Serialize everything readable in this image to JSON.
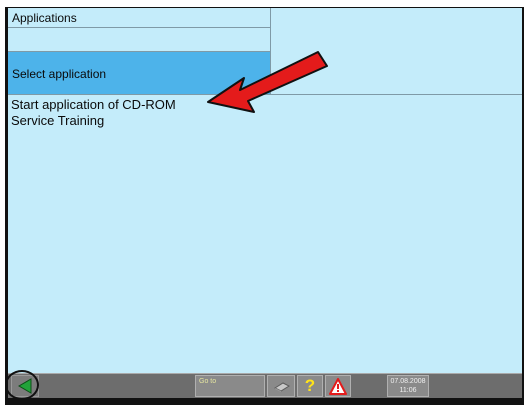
{
  "header": {
    "title": "Applications",
    "selection_prompt": "Select application"
  },
  "applications": [
    {
      "label": "Start application of CD-ROM"
    },
    {
      "label": "Service Training"
    }
  ],
  "toolbar": {
    "goto_label": "Go to",
    "help_label": "?",
    "date": "07.08.2008",
    "time": "11:06"
  },
  "colors": {
    "screen_bg": "#c4ecfa",
    "selected_bg": "#4db3ea",
    "toolbar_bg": "#6d6d6d",
    "arrow": "#e41b1b"
  },
  "icons": [
    "back-arrow-icon",
    "printer-icon",
    "help-icon",
    "warning-icon",
    "annotation-arrow-icon"
  ]
}
